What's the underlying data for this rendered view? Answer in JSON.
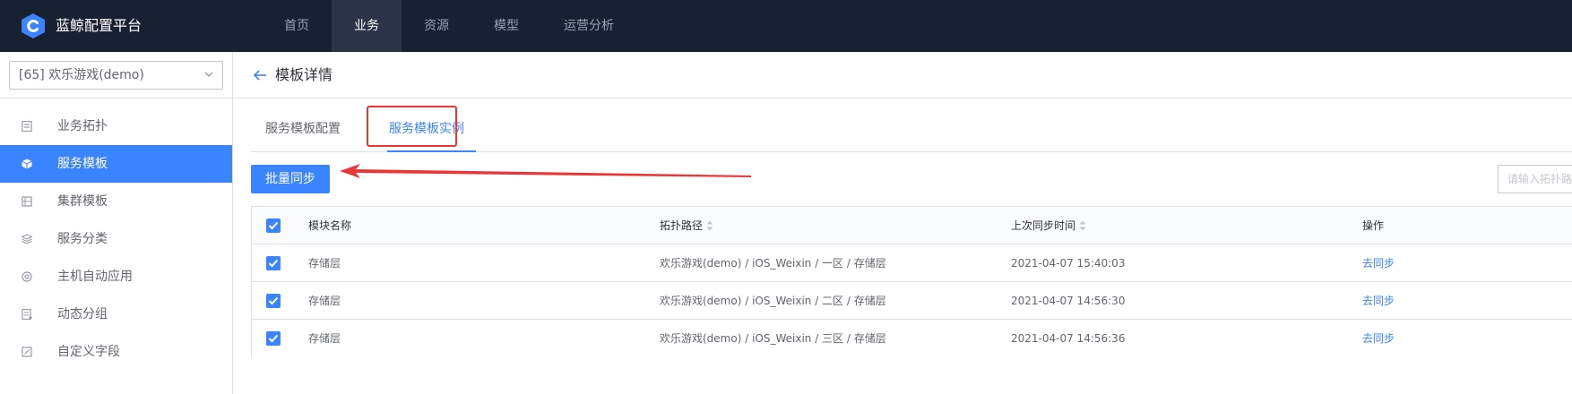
{
  "header": {
    "app_title": "蓝鲸配置平台",
    "nav": [
      {
        "label": "首页",
        "active": false
      },
      {
        "label": "业务",
        "active": true
      },
      {
        "label": "资源",
        "active": false
      },
      {
        "label": "模型",
        "active": false
      },
      {
        "label": "运营分析",
        "active": false
      }
    ]
  },
  "sidebar": {
    "business_select": "[65] 欢乐游戏(demo)",
    "items": [
      {
        "label": "业务拓扑",
        "icon": "topology-icon",
        "active": false
      },
      {
        "label": "服务模板",
        "icon": "cube-icon",
        "active": true
      },
      {
        "label": "集群模板",
        "icon": "cluster-icon",
        "active": false
      },
      {
        "label": "服务分类",
        "icon": "layers-icon",
        "active": false
      },
      {
        "label": "主机自动应用",
        "icon": "auto-apply-icon",
        "active": false
      },
      {
        "label": "动态分组",
        "icon": "group-icon",
        "active": false
      },
      {
        "label": "自定义字段",
        "icon": "custom-field-icon",
        "active": false
      }
    ]
  },
  "page": {
    "title": "模板详情",
    "tabs": [
      {
        "label": "服务模板配置",
        "active": false
      },
      {
        "label": "服务模板实例",
        "active": true
      }
    ],
    "batch_sync_label": "批量同步",
    "search_placeholder": "请输入拓扑路径"
  },
  "table": {
    "columns": [
      "模块名称",
      "拓扑路径",
      "上次同步时间",
      "操作"
    ],
    "rows": [
      {
        "checked": true,
        "module": "存储层",
        "path": "欢乐游戏(demo) / iOS_Weixin / 一区 / 存储层",
        "last_sync": "2021-04-07 15:40:03",
        "action": "去同步"
      },
      {
        "checked": true,
        "module": "存储层",
        "path": "欢乐游戏(demo) / iOS_Weixin / 二区 / 存储层",
        "last_sync": "2021-04-07 14:56:30",
        "action": "去同步"
      },
      {
        "checked": true,
        "module": "存储层",
        "path": "欢乐游戏(demo) / iOS_Weixin / 三区 / 存储层",
        "last_sync": "2021-04-07 14:56:36",
        "action": "去同步"
      }
    ]
  },
  "colors": {
    "topbar_bg": "#182132",
    "accent": "#3a84ff",
    "highlight_red": "#ea3636"
  }
}
